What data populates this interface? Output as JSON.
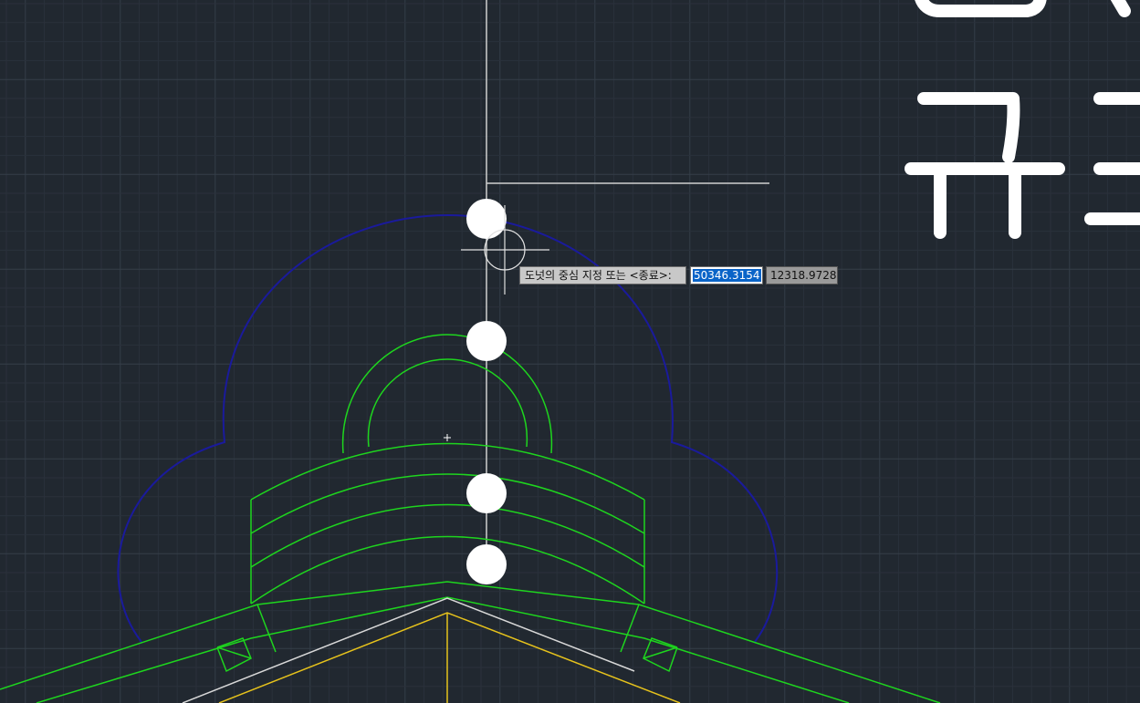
{
  "command_prompt": {
    "label": "도넛의 중심 지정 또는 <종료>:",
    "x_value": "50346.3154",
    "y_value": "12318.9728"
  },
  "drawing_text": {
    "large_text_partial": "규조"
  },
  "colors": {
    "background": "#212830",
    "grid_minor": "#2a313b",
    "grid_major": "#353e49",
    "outline_blue": "#1a1a9c",
    "linework_green": "#1ed51e",
    "linework_yellow": "#e6c21c",
    "linework_white": "#d8d8d8",
    "donut_fill": "#ffffff"
  },
  "icons": [
    "crosshair-cursor-icon",
    "ucs-origin-marker-icon"
  ]
}
